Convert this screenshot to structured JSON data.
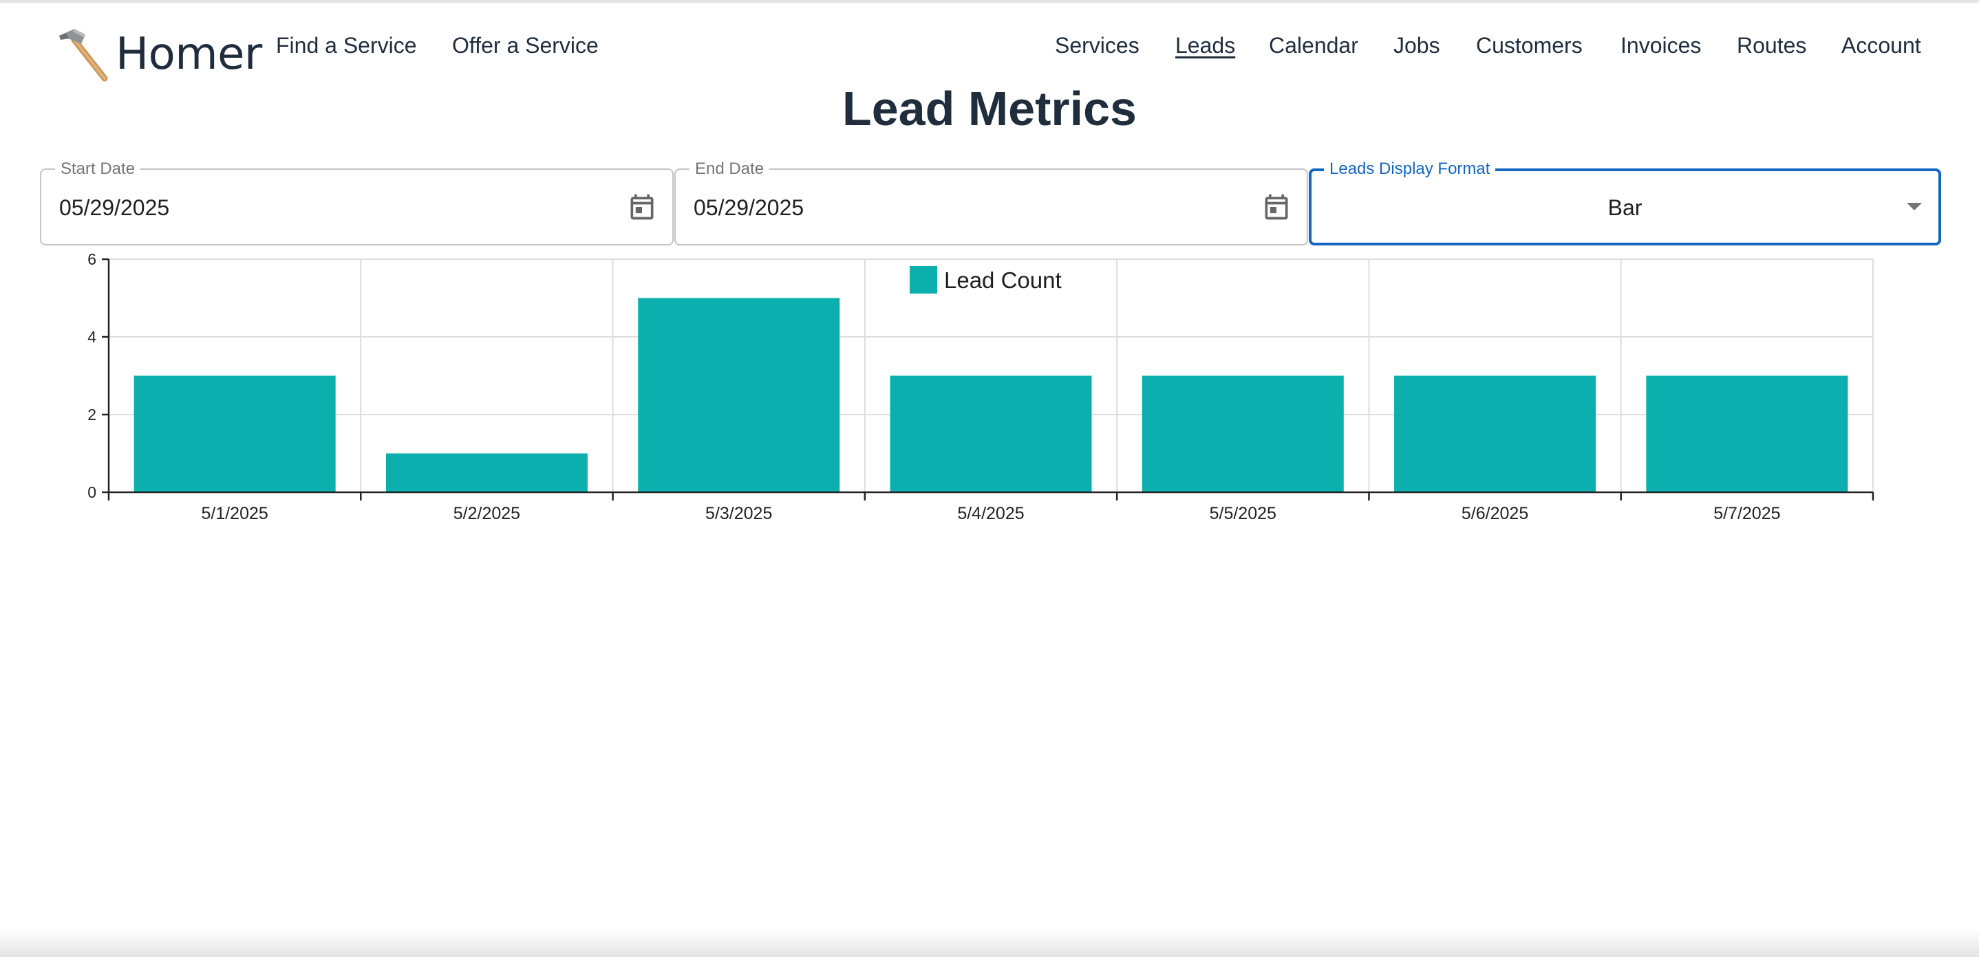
{
  "nav": {
    "brand": "Homer",
    "brand_icon": "hammer-icon",
    "left_links": [
      {
        "name": "nav-find-a-service",
        "label": "Find a Service"
      },
      {
        "name": "nav-offer-a-service",
        "label": "Offer a Service"
      }
    ],
    "right_links": [
      {
        "name": "nav-services",
        "label": "Services",
        "active": false
      },
      {
        "name": "nav-leads",
        "label": "Leads",
        "active": true
      },
      {
        "name": "nav-calendar",
        "label": "Calendar",
        "active": false
      },
      {
        "name": "nav-jobs",
        "label": "Jobs",
        "active": false
      },
      {
        "name": "nav-customers",
        "label": "Customers",
        "active": false
      },
      {
        "name": "nav-invoices",
        "label": "Invoices",
        "active": false
      },
      {
        "name": "nav-routes",
        "label": "Routes",
        "active": false
      },
      {
        "name": "nav-account",
        "label": "Account",
        "active": false
      }
    ]
  },
  "page": {
    "title": "Lead Metrics"
  },
  "filters": {
    "start_date": {
      "label": "Start Date",
      "value": "05/29/2025",
      "icon": "calendar-icon"
    },
    "end_date": {
      "label": "End Date",
      "value": "05/29/2025",
      "icon": "calendar-icon"
    },
    "display_format": {
      "label": "Leads Display Format",
      "value": "Bar",
      "icon": "dropdown-arrow-icon"
    }
  },
  "colors": {
    "bar": "#0bb0ae",
    "text": "#1f2d3d",
    "focus": "#1565c0",
    "grid": "#dddddd"
  },
  "chart_data": {
    "type": "bar",
    "categories": [
      "5/1/2025",
      "5/2/2025",
      "5/3/2025",
      "5/4/2025",
      "5/5/2025",
      "5/6/2025",
      "5/7/2025"
    ],
    "series": [
      {
        "name": "Lead Count",
        "values": [
          3,
          1,
          5,
          3,
          3,
          3,
          3
        ]
      }
    ],
    "ylim": [
      0,
      6
    ],
    "yticks": [
      0,
      2,
      4,
      6
    ],
    "grid": true,
    "legend": "top-center"
  }
}
